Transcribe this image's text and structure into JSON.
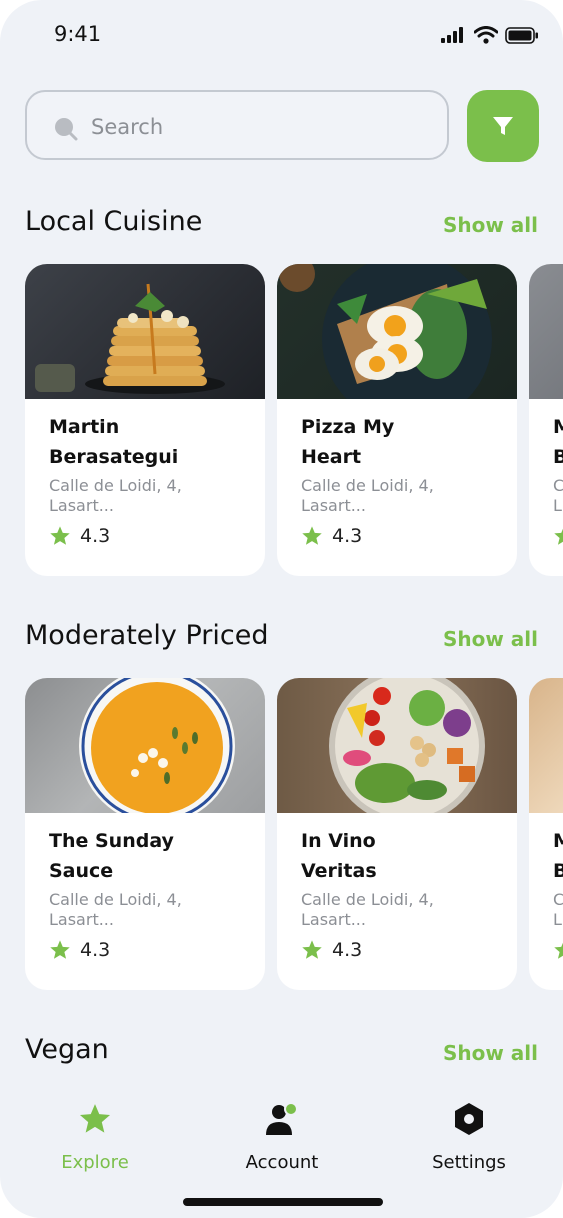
{
  "status_bar": {
    "time": "9:41"
  },
  "search": {
    "placeholder": "Search"
  },
  "colors": {
    "accent": "#7bbf4b",
    "background": "#eff2f7"
  },
  "sections": [
    {
      "title": "Local Cuisine",
      "show_all": "Show all",
      "cards": [
        {
          "name_line1": "Martin",
          "name_line2": "Berasategui",
          "address_line1": "Calle de Loidi, 4,",
          "address_line2": "Lasart...",
          "rating": "4.3"
        },
        {
          "name_line1": "Pizza My",
          "name_line2": "Heart",
          "address_line1": "Calle de Loidi, 4,",
          "address_line2": "Lasart...",
          "rating": "4.3"
        },
        {
          "name_line1": "M",
          "name_line2": "B",
          "address_line1": "C",
          "address_line2": "L"
        }
      ]
    },
    {
      "title": "Moderately Priced",
      "show_all": "Show all",
      "cards": [
        {
          "name_line1": "The Sunday",
          "name_line2": "Sauce",
          "address_line1": "Calle de Loidi, 4,",
          "address_line2": "Lasart...",
          "rating": "4.3"
        },
        {
          "name_line1": "In Vino",
          "name_line2": "Veritas",
          "address_line1": "Calle de Loidi, 4,",
          "address_line2": "Lasart...",
          "rating": "4.3"
        },
        {
          "name_line1": "M",
          "name_line2": "B",
          "address_line1": "C",
          "address_line2": "L"
        }
      ]
    },
    {
      "title": "Vegan",
      "show_all": "Show all"
    }
  ],
  "nav": {
    "explore": "Explore",
    "account": "Account",
    "settings": "Settings"
  }
}
